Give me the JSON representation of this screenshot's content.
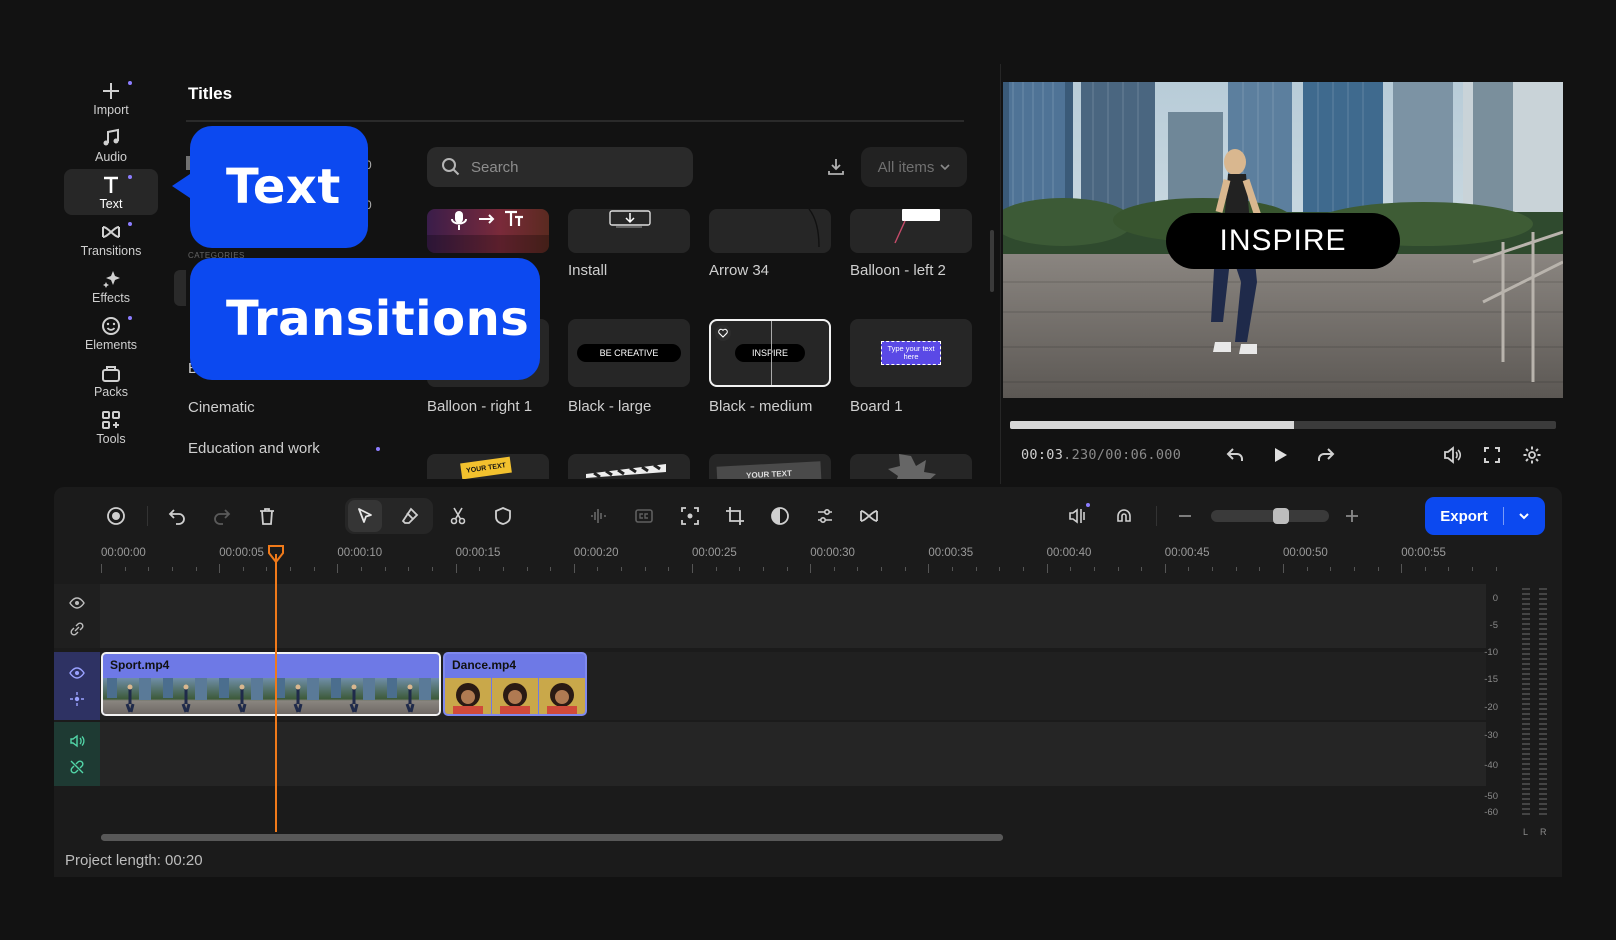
{
  "sidebar": {
    "items": [
      {
        "label": "Import",
        "icon": "plus-icon"
      },
      {
        "label": "Audio",
        "icon": "music-note-icon"
      },
      {
        "label": "Text",
        "icon": "text-icon"
      },
      {
        "label": "Transitions",
        "icon": "bowtie-icon"
      },
      {
        "label": "Effects",
        "icon": "sparkle-icon"
      },
      {
        "label": "Elements",
        "icon": "smiley-icon"
      },
      {
        "label": "Packs",
        "icon": "bag-icon"
      },
      {
        "label": "Tools",
        "icon": "grid-plus-icon"
      }
    ]
  },
  "titles_panel": {
    "heading": "Titles",
    "search_placeholder": "Search",
    "filter_label": "All items",
    "category_header": "CATEGORIES",
    "counts": [
      "0",
      "0"
    ],
    "categories_partial": [
      "B"
    ],
    "categories": [
      "Cinematic",
      "Education and work"
    ],
    "thumbs_row1": [
      {
        "label": "",
        "kind": "mic-to-text"
      },
      {
        "label": "Install",
        "kind": "install"
      },
      {
        "label": "Arrow 34",
        "kind": "arrow"
      },
      {
        "label": "Balloon - left 2",
        "kind": "balloon"
      }
    ],
    "thumbs_row2": [
      {
        "label": "Balloon - right 1",
        "kind": "blank"
      },
      {
        "label": "Black - large",
        "text": "BE CREATIVE"
      },
      {
        "label": "Black - medium",
        "text": "INSPIRE"
      },
      {
        "label": "Board 1",
        "text": "Type your text here"
      }
    ],
    "thumbs_row3_texts": [
      "YOUR TEXT",
      "",
      "YOUR TEXT",
      ""
    ]
  },
  "callouts": {
    "text": "Text",
    "transitions": "Transitions"
  },
  "preview": {
    "overlay_text": "INSPIRE",
    "timecode_current": "00:03",
    "timecode_ms": ".230",
    "timecode_total": "/00:06.000",
    "progress": 0.52
  },
  "toolbar": {
    "export_label": "Export"
  },
  "timeline": {
    "ruler": [
      "00:00:00",
      "00:00:05",
      "00:00:10",
      "00:00:15",
      "00:00:20",
      "00:00:25",
      "00:00:30",
      "00:00:35",
      "00:00:40",
      "00:00:45",
      "00:00:50",
      "00:00:55"
    ],
    "clips": [
      {
        "name": "Sport.mp4"
      },
      {
        "name": "Dance.mp4"
      }
    ],
    "db_scale": [
      "0",
      "-5",
      "-10",
      "-15",
      "-20",
      "-30",
      "-40",
      "-50",
      "-60"
    ],
    "channels": [
      "L",
      "R"
    ],
    "project_length": "Project length: 00:20"
  },
  "colors": {
    "accent": "#0c49f0",
    "playhead": "#f07a1a",
    "clip": "#6e79e6",
    "purple_dot": "#8c7dff"
  }
}
